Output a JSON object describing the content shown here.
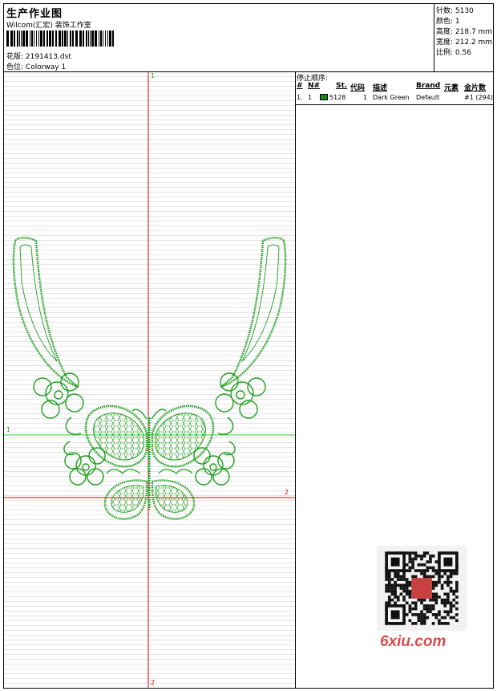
{
  "header": {
    "title": "生产作业图",
    "company": "Wilcom(汇宏) 装饰工作室",
    "design_label": "花版:",
    "design_value": "2191413.dst",
    "colorway_label": "色位:",
    "colorway_value": "Colorway 1"
  },
  "stats": [
    {
      "label": "针数:",
      "value": "5130"
    },
    {
      "label": "颜色:",
      "value": "1"
    },
    {
      "label": "高度:",
      "value": "218.7 mm"
    },
    {
      "label": "宽度:",
      "value": "212.2 mm"
    },
    {
      "label": "比例:",
      "value": "0.56"
    }
  ],
  "crosshair_labels": {
    "top": "1",
    "bottom": "2",
    "left": "1",
    "right": "2"
  },
  "stop_sequence": {
    "title": "停止顺序:",
    "headers": [
      "#",
      "N#",
      "St.",
      "代码",
      "描述",
      "Brand",
      "元素",
      "金片数"
    ],
    "rows": [
      {
        "num": "1.",
        "n": "1",
        "swatch_color": "#1a8a1a",
        "stitches": "5128",
        "code": "1",
        "description": "Dark Green",
        "brand": "Default",
        "sequins": "#1 (294)"
      }
    ]
  },
  "watermark": "6xiu.com",
  "colors": {
    "thread": "#1f9e1f",
    "axis_red": "#e00000",
    "axis_green": "#2fcc2f"
  }
}
